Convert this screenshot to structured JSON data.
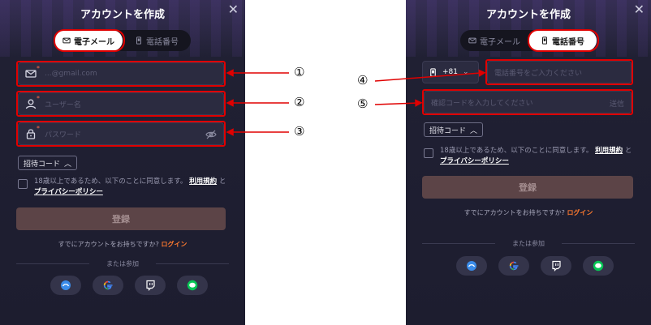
{
  "left": {
    "title": "アカウントを作成",
    "tabs": [
      {
        "label": "電子メール",
        "active": true
      },
      {
        "label": "電話番号",
        "active": false
      }
    ],
    "email_placeholder": "...@gmail.com",
    "username_placeholder": "ユーザー名",
    "password_placeholder": "パスワード",
    "invite_label": "招待コード",
    "agree_text": "18歳以上であるため、以下のことに同意します。",
    "terms_link": "利用規約",
    "and_text": "と",
    "privacy_link": "プライバシーポリシー",
    "register_label": "登録",
    "already_text": "すでにアカウントをお持ちですか?",
    "login_link": "ログイン",
    "or_text": "または参加"
  },
  "right": {
    "title": "アカウントを作成",
    "tabs": [
      {
        "label": "電子メール",
        "active": false
      },
      {
        "label": "電話番号",
        "active": true
      }
    ],
    "country_code": "+81",
    "phone_placeholder": "電話番号をご入力ください",
    "code_placeholder": "確認コードを入力してください",
    "send_label": "送信",
    "invite_label": "招待コード",
    "agree_text": "18歳以上であるため、以下のことに同意します。",
    "terms_link": "利用規約",
    "and_text": "と",
    "privacy_link": "プライバシーポリシー",
    "register_label": "登録",
    "already_text": "すでにアカウントをお持ちですか?",
    "login_link": "ログイン",
    "or_text": "または参加"
  },
  "annotations": [
    "①",
    "②",
    "③",
    "④",
    "⑤"
  ],
  "social_icons": [
    "steam-like-icon",
    "google-icon",
    "twitch-icon",
    "line-icon"
  ],
  "colors": {
    "highlight": "#e00000",
    "login": "#ff7a2f",
    "register_bg": "#5c4447"
  }
}
